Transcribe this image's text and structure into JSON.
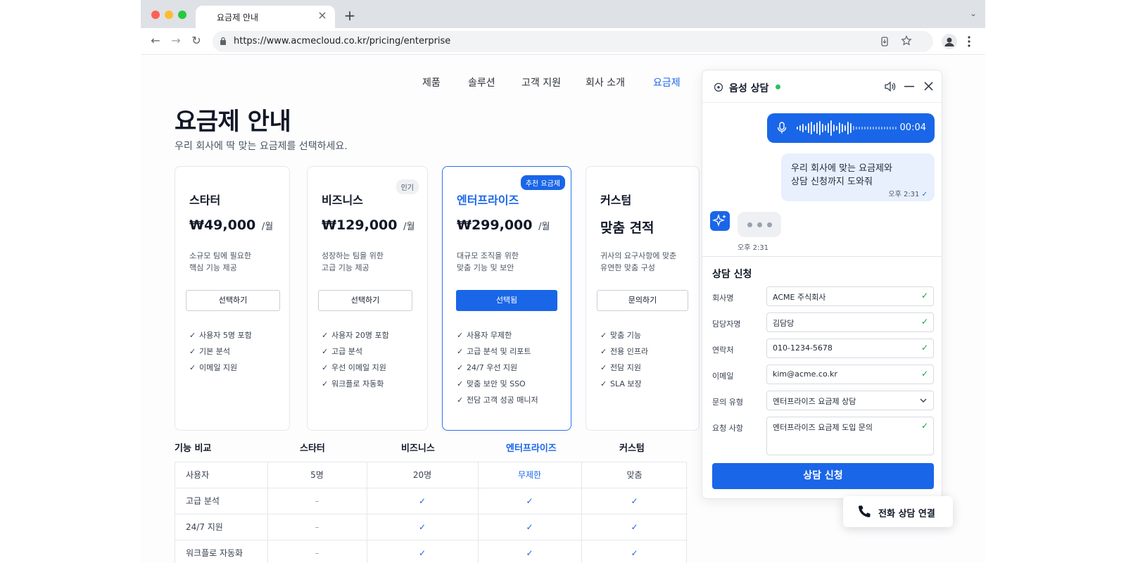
{
  "browser": {
    "tab_title": "요금제 안내",
    "tab_close": "×",
    "new_tab": "+",
    "tab_menu": "⌄",
    "url": "https://www.acmecloud.co.kr/pricing/enterprise",
    "back": "←",
    "forward": "→",
    "reload": "↻"
  },
  "nav": {
    "items": [
      "제품",
      "솔루션",
      "고객 지원",
      "회사 소개",
      "요금제"
    ]
  },
  "hero": {
    "title": "요금제 안내",
    "subtitle": "우리 회사에 딱 맞는 요금제를 선택하세요."
  },
  "plans": [
    {
      "name": "스타터",
      "price": "₩49,000",
      "per": "/월",
      "desc": [
        "소규모 팀에 필요한",
        "핵심 기능 제공"
      ],
      "button": "선택하기",
      "features": [
        "사용자 5명 포함",
        "기본 분석",
        "이메일 지원"
      ]
    },
    {
      "name": "비즈니스",
      "price": "₩129,000",
      "per": "/월",
      "badge": "인기",
      "desc": [
        "성장하는 팀을 위한",
        "고급 기능 제공"
      ],
      "button": "선택하기",
      "features": [
        "사용자 20명 포함",
        "고급 분석",
        "우선 이메일 지원",
        "워크플로 자동화"
      ]
    },
    {
      "name": "엔터프라이즈",
      "price": "₩299,000",
      "per": "/월",
      "badge": "추천 요금제",
      "desc": [
        "대규모 조직을 위한",
        "맞춤 기능 및 보안"
      ],
      "button": "선택됨",
      "features": [
        "사용자 무제한",
        "고급 분석 및 리포트",
        "24/7 우선 지원",
        "맞춤 보안 및 SSO",
        "전담 고객 성공 매니저"
      ]
    },
    {
      "name": "커스텀",
      "price": "맞춤 견적",
      "desc": [
        "귀사의 요구사항에 맞춘",
        "유연한 맞춤 구성"
      ],
      "button": "문의하기",
      "features": [
        "맞춤 기능",
        "전용 인프라",
        "전담 지원",
        "SLA 보장"
      ]
    }
  ],
  "comparison": {
    "title": "기능 비교",
    "columns": [
      "스타터",
      "비즈니스",
      "엔터프라이즈",
      "커스텀"
    ],
    "rows": [
      {
        "label": "사용자",
        "cells": [
          "5명",
          "20명",
          "무제한",
          "맞춤"
        ]
      },
      {
        "label": "고급 분석",
        "cells": [
          "–",
          "✓",
          "✓",
          "✓"
        ]
      },
      {
        "label": "24/7 지원",
        "cells": [
          "–",
          "✓",
          "✓",
          "✓"
        ]
      },
      {
        "label": "워크플로 자동화",
        "cells": [
          "–",
          "✓",
          "✓",
          "✓"
        ]
      }
    ]
  },
  "voice_panel": {
    "title": "음성 상담",
    "status_color": "#22c55e",
    "audio_duration": "00:04",
    "user_message": [
      "우리 회사에 맞는 요금제와",
      "상담 신청까지 도와줘"
    ],
    "user_time": "오후 2:31",
    "ai_time": "오후 2:31",
    "form": {
      "title": "상담 신청",
      "fields": [
        {
          "label": "회사명",
          "value": "ACME 주식회사"
        },
        {
          "label": "담당자명",
          "value": "김담당"
        },
        {
          "label": "연락처",
          "value": "010-1234-5678"
        },
        {
          "label": "이메일",
          "value": "kim@acme.co.kr"
        },
        {
          "label": "문의 유형",
          "value": "엔터프라이즈 요금제 상담"
        },
        {
          "label": "요청 사항",
          "value": "엔터프라이즈 요금제 도입 문의"
        }
      ],
      "submit": "상담 신청"
    }
  },
  "phone_button": {
    "label": "전화 상담 연결"
  },
  "colors": {
    "accent": "#1a66e8",
    "success": "#16a34a"
  }
}
